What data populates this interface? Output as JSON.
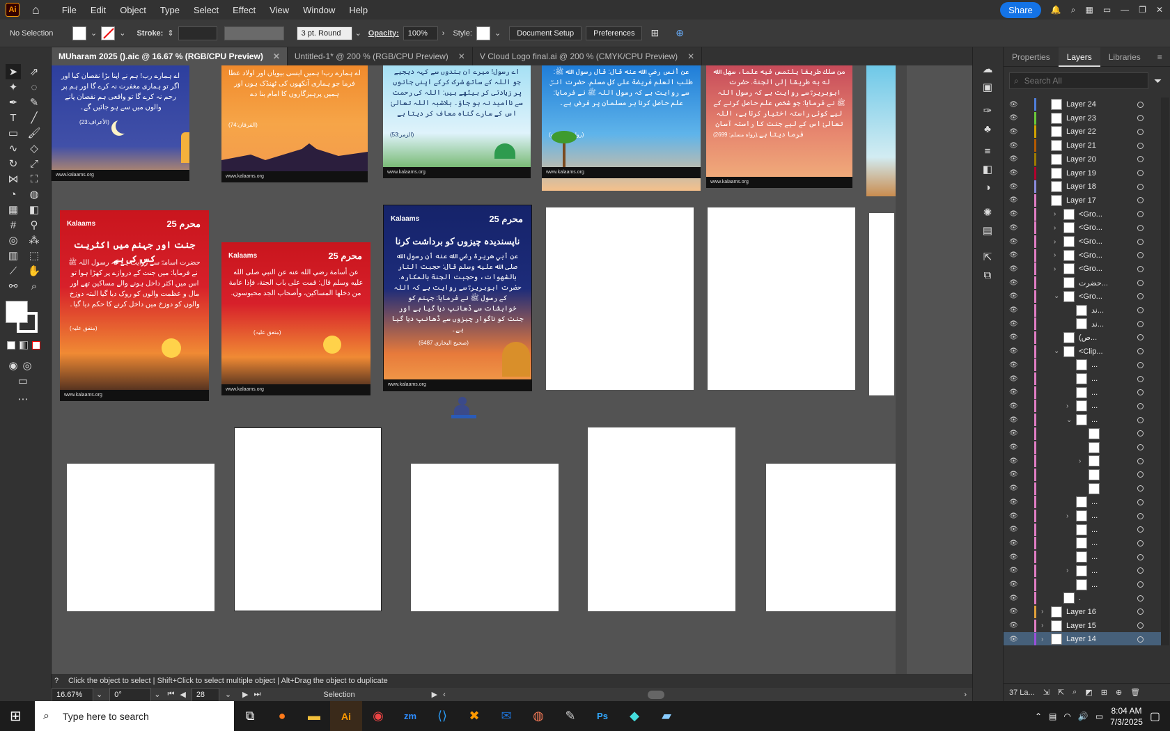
{
  "app": {
    "logo": "Ai",
    "menu": [
      "File",
      "Edit",
      "Object",
      "Type",
      "Select",
      "Effect",
      "View",
      "Window",
      "Help"
    ],
    "share_label": "Share"
  },
  "control": {
    "selection": "No Selection",
    "stroke_label": "Stroke:",
    "brush": "3 pt. Round",
    "opacity_label": "Opacity:",
    "opacity_value": "100%",
    "style_label": "Style:",
    "doc_setup": "Document Setup",
    "preferences": "Preferences"
  },
  "tabs": [
    {
      "label": "MUharam 2025 ().aic @ 16.67 % (RGB/CPU Preview)"
    },
    {
      "label": "Untitled-1* @ 200 % (RGB/CPU Preview)"
    },
    {
      "label": "V Cloud Logo final.ai @ 200 % (CMYK/CPU Preview)"
    }
  ],
  "posters": [
    {
      "text": "اے ہمارے رب! ہم نے اپنا بڑا نقصان کیا اور اگر تو ہماری مغفرت نہ کرے گا اور ہم پر رحم نہ کرے گا تو واقعی ہم نقصان پانے والوں میں سے ہو جائیں گے۔",
      "ref": "(الأعراف:23)",
      "footer": "www.kalaams.org"
    },
    {
      "text": "اے ہمارے رب! ہمیں ایسی بیویاں اور اولاد عطا فرما جو ہماری آنکھوں کی ٹھنڈک ہوں اور ہمیں پرہیزگاروں کا امام بنا دے",
      "ref": "(الفرقان:74)",
      "footer": "www.kalaams.org"
    },
    {
      "text": "اے رسول! میرے ان بندوں سے کہہ دیجیے جو اللہ کے ساتھ شرک کرکے اپنی جانوں پر زیادتی کر بیٹھے ہیں: اللہ کی رحمت سے ناامید نہ ہو جاؤ۔ بلاشبہ اللہ تعالیٰ اس کے سارے گناہ معاف کر دیتا ہے",
      "ref": "(الزمر:53)",
      "footer": "www.kalaams.org"
    },
    {
      "text": "عن أنس رضي الله عنه قال: قال رسول الله ﷺ: طلب العلم فريضة على كل مسلم. حضرت انسؓ سے روایت ہے کہ رسول اللہ ﷺ نے فرمایا: علم حاصل کرنا ہر مسلمان پر فرض ہے۔",
      "ref": "(رواه ابن ماجه)",
      "footer": "www.kalaams.org"
    },
    {
      "text": "من سلك طريقا يلتمس فيه علما، سهل الله له به طريقا إلى الجنة. حضرت ابوہریرہؓ سے روایت ہے کہ رسول اللہ ﷺ نے فرمایا: جو شخص علم حاصل کرنے کے لیے کوئی راستہ اختیار کرتا ہے، اللہ تعالیٰ اس کے لیے جنت کا راستہ آسان فرما دیتا ہے۔",
      "ref": "(رواه مسلم: 2699)",
      "footer": "www.kalaams.org"
    },
    {
      "brand": "Kalaams",
      "muh": "محرم 25",
      "title": "جنت اور جہنم میں اکثریت کس کی ہے",
      "text": "حضرت اسامہؓ سے روایت ہے کہ رسول اللہ ﷺ نے فرمایا: میں جنت کے دروازے پر کھڑا ہوا تو اس میں اکثر داخل ہونے والے مساکین تھے اور مال و عظمت والوں کو روک دیا گیا البتہ دوزخ والوں کو دوزخ میں داخل کرنے کا حکم دیا گیا۔",
      "ref": "(متفق علیہ)",
      "footer": "www.kalaams.org"
    },
    {
      "brand": "Kalaams",
      "muh": "محرم 25",
      "text": "عن أسامة رضي الله عنه عن النبي صلى الله عليه وسلم قال: قمت على باب الجنة، فإذا عامة من دخلها المساكين، وأصحاب الجد محبوسون.",
      "ref": "(متفق علیہ)",
      "footer": "www.kalaams.org"
    },
    {
      "brand": "Kalaams",
      "muh": "محرم 25",
      "title": "ناپسندیدہ چیزوں کو برداشت کرنا",
      "text": "عن أبي هريرة رضي الله عنه أن رسول الله صلى الله عليه وسلم قال: حجبت النار بالشهوات، وحجبت الجنة بالمكاره. حضرت ابوہریرہؓ سے روایت ہے کہ اللہ کے رسول ﷺ نے فرمایا: جہنم کو خواہشات سے ڈھانپ دیا گیا ہے اور جنت کو ناگوار چیزوں سے ڈھانپ دیا گیا ہے۔",
      "ref": "(صحیح البخاري 6487)",
      "footer": "www.kalaams.org"
    }
  ],
  "layers_panel": {
    "tabs": [
      "Properties",
      "Layers",
      "Libraries"
    ],
    "search_placeholder": "Search All",
    "count": "37 La..."
  },
  "layers": [
    {
      "name": "Layer 24",
      "color": "#4f7fdb",
      "indent": 0
    },
    {
      "name": "Layer 23",
      "color": "#6bc93a",
      "indent": 0
    },
    {
      "name": "Layer 22",
      "color": "#d1a200",
      "indent": 0
    },
    {
      "name": "Layer 21",
      "color": "#b35a00",
      "indent": 0
    },
    {
      "name": "Layer 20",
      "color": "#9e7b00",
      "indent": 0
    },
    {
      "name": "Layer 19",
      "color": "#b3002d",
      "indent": 0
    },
    {
      "name": "Layer 18",
      "color": "#8a8adb",
      "indent": 0
    },
    {
      "name": "Layer 17",
      "color": "#e07dc4",
      "indent": 0,
      "open": true
    },
    {
      "name": "<Gro...",
      "color": "#e07dc4",
      "indent": 1,
      "arrow": "›"
    },
    {
      "name": "<Gro...",
      "color": "#e07dc4",
      "indent": 1,
      "arrow": "›"
    },
    {
      "name": "<Gro...",
      "color": "#e07dc4",
      "indent": 1,
      "arrow": "›"
    },
    {
      "name": "<Gro...",
      "color": "#e07dc4",
      "indent": 1,
      "arrow": "›"
    },
    {
      "name": "<Gro...",
      "color": "#e07dc4",
      "indent": 1,
      "arrow": "›"
    },
    {
      "name": "حضرت...",
      "color": "#e07dc4",
      "indent": 1
    },
    {
      "name": "<Gro...",
      "color": "#e07dc4",
      "indent": 1,
      "arrow": "⌄"
    },
    {
      "name": "ند...",
      "color": "#e07dc4",
      "indent": 2
    },
    {
      "name": "ند...",
      "color": "#e07dc4",
      "indent": 2
    },
    {
      "name": "(ص...",
      "color": "#e07dc4",
      "indent": 1
    },
    {
      "name": "<Clip...",
      "color": "#e07dc4",
      "indent": 1,
      "arrow": "⌄"
    },
    {
      "name": "...",
      "color": "#e07dc4",
      "indent": 2
    },
    {
      "name": "...",
      "color": "#e07dc4",
      "indent": 2
    },
    {
      "name": "...",
      "color": "#e07dc4",
      "indent": 2
    },
    {
      "name": "...",
      "color": "#e07dc4",
      "indent": 2,
      "arrow": "›"
    },
    {
      "name": "...",
      "color": "#e07dc4",
      "indent": 2,
      "arrow": "⌄"
    },
    {
      "name": "",
      "color": "#e07dc4",
      "indent": 3
    },
    {
      "name": "",
      "color": "#e07dc4",
      "indent": 3
    },
    {
      "name": "",
      "color": "#e07dc4",
      "indent": 3,
      "arrow": "›"
    },
    {
      "name": "",
      "color": "#e07dc4",
      "indent": 3
    },
    {
      "name": "",
      "color": "#e07dc4",
      "indent": 3
    },
    {
      "name": "...",
      "color": "#e07dc4",
      "indent": 2
    },
    {
      "name": "...",
      "color": "#e07dc4",
      "indent": 2,
      "arrow": "›"
    },
    {
      "name": "...",
      "color": "#e07dc4",
      "indent": 2
    },
    {
      "name": "...",
      "color": "#e07dc4",
      "indent": 2
    },
    {
      "name": "...",
      "color": "#e07dc4",
      "indent": 2
    },
    {
      "name": "...",
      "color": "#e07dc4",
      "indent": 2,
      "arrow": "›"
    },
    {
      "name": "...",
      "color": "#e07dc4",
      "indent": 2
    },
    {
      "name": ".",
      "color": "#e07dc4",
      "indent": 1
    },
    {
      "name": "Layer 16",
      "color": "#e0a03a",
      "indent": 0,
      "arrow": "›"
    },
    {
      "name": "Layer 15",
      "color": "#e07dc4",
      "indent": 0,
      "arrow": "›"
    },
    {
      "name": "Layer 14",
      "color": "#9a4fdb",
      "indent": 0,
      "arrow": "›",
      "selected": true
    }
  ],
  "status": {
    "hint": "Click the object to select  |  Shift+Click to select multiple object  |  Alt+Drag the object to duplicate",
    "zoom": "16.67%",
    "angle": "0°",
    "artboard": "28",
    "tool": "Selection"
  },
  "taskbar": {
    "search_placeholder": "Type here to search",
    "time": "8:04 AM",
    "date": "7/3/2025"
  }
}
